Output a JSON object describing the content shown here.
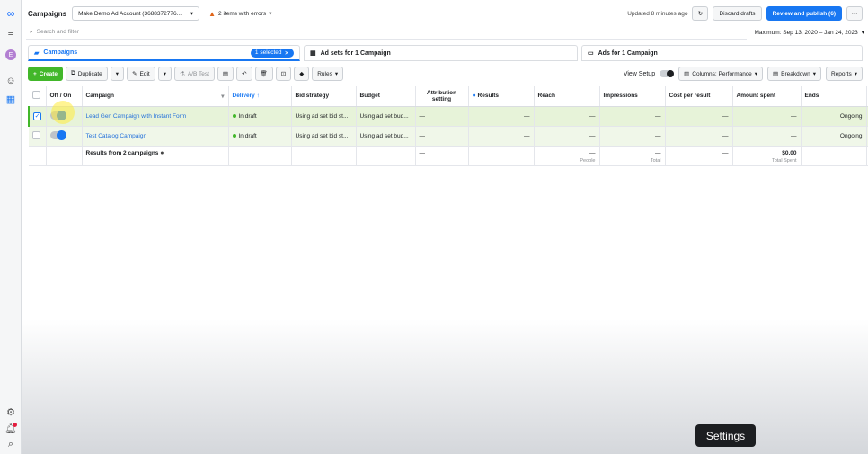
{
  "rail": {
    "logo": "meta-icon",
    "avatar_letter": "E"
  },
  "topbar": {
    "title": "Campaigns",
    "account": "Make Demo Ad Account (3688372776...",
    "errors": "2 items with errors",
    "updated": "Updated 8 minutes ago",
    "discard": "Discard drafts",
    "publish": "Review and publish (6)",
    "more": "···"
  },
  "search": {
    "placeholder": "Search and filter",
    "date_range": "Maximum: Sep 13, 2020 – Jan 24, 2023"
  },
  "tabs": {
    "campaigns": "Campaigns",
    "selected": "1 selected",
    "adsets": "Ad sets for 1 Campaign",
    "ads": "Ads for 1 Campaign"
  },
  "toolbar": {
    "create": "Create",
    "duplicate": "Duplicate",
    "edit": "Edit",
    "abtest": "A/B Test",
    "rules": "Rules",
    "view_setup": "View Setup",
    "columns": "Columns: Performance",
    "breakdown": "Breakdown",
    "reports": "Reports"
  },
  "table": {
    "headers": {
      "offon": "Off / On",
      "campaign": "Campaign",
      "delivery": "Delivery ↑",
      "bid": "Bid strategy",
      "budget": "Budget",
      "attribution": "Attribution setting",
      "results": "Results",
      "reach": "Reach",
      "impressions": "Impressions",
      "cpr": "Cost per result",
      "spent": "Amount spent",
      "ends": "Ends"
    },
    "rows": [
      {
        "name": "Lead Gen Campaign with Instant Form",
        "delivery": "In draft",
        "bid": "Using ad set bid st...",
        "budget": "Using ad set bud...",
        "attribution": "—",
        "results": "—",
        "reach": "—",
        "impressions": "—",
        "cpr": "—",
        "spent": "—",
        "ends": "Ongoing"
      },
      {
        "name": "Test Catalog Campaign",
        "delivery": "In draft",
        "bid": "Using ad set bid st...",
        "budget": "Using ad set bud...",
        "attribution": "—",
        "results": "—",
        "reach": "—",
        "impressions": "—",
        "cpr": "—",
        "spent": "—",
        "ends": "Ongoing"
      }
    ],
    "summary": {
      "label": "Results from 2 campaigns",
      "attribution": "—",
      "reach": "—",
      "reach_sub": "People",
      "impressions": "—",
      "impressions_sub": "Total",
      "cpr": "—",
      "spent": "$0.00",
      "spent_sub": "Total Spent"
    }
  },
  "tooltip": "Settings"
}
